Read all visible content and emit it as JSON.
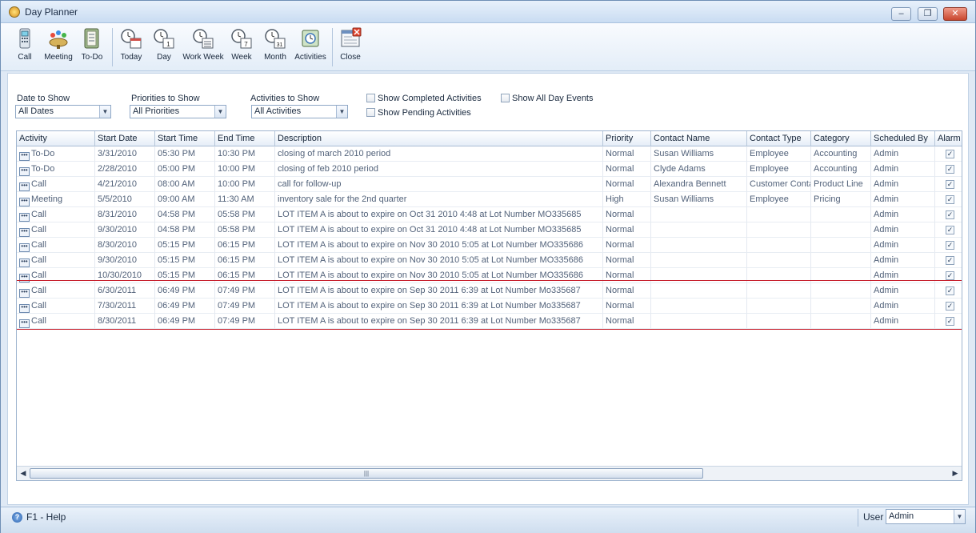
{
  "window": {
    "title": "Day Planner",
    "controls": {
      "minimize": "–",
      "restore": "❐",
      "close": "✕"
    }
  },
  "toolbar": {
    "buttons": [
      {
        "label": "Call",
        "icon": "phone-icon"
      },
      {
        "label": "Meeting",
        "icon": "meeting-icon"
      },
      {
        "label": "To-Do",
        "icon": "todo-icon"
      },
      {
        "label": "Today",
        "icon": "today-icon"
      },
      {
        "label": "Day",
        "icon": "day-icon"
      },
      {
        "label": "Work Week",
        "icon": "work-week-icon"
      },
      {
        "label": "Week",
        "icon": "week-icon"
      },
      {
        "label": "Month",
        "icon": "month-icon"
      },
      {
        "label": "Activities",
        "icon": "activities-icon"
      },
      {
        "label": "Close",
        "icon": "close-icon"
      }
    ],
    "icon_numbers": {
      "day": "1",
      "week": "7",
      "month": "31"
    }
  },
  "filters": {
    "date_label": "Date to Show",
    "date_value": "All Dates",
    "priorities_label": "Priorities to Show",
    "priorities_value": "All Priorities",
    "activities_label": "Activities to Show",
    "activities_value": "All Activities",
    "show_completed": "Show Completed Activities",
    "show_pending": "Show Pending Activities",
    "show_all_day": "Show All Day Events"
  },
  "grid": {
    "columns": [
      "Activity",
      "Start Date",
      "Start Time",
      "End Time",
      "Description",
      "Priority",
      "Contact Name",
      "Contact Type",
      "Category",
      "Scheduled By",
      "Alarm"
    ],
    "rows": [
      [
        "To-Do",
        "3/31/2010",
        "05:30 PM",
        "10:30 PM",
        "closing of march 2010 period",
        "Normal",
        "Susan Williams",
        "Employee",
        "Accounting",
        "Admin"
      ],
      [
        "To-Do",
        "2/28/2010",
        "05:00 PM",
        "10:00 PM",
        "closing of feb 2010 period",
        "Normal",
        "Clyde Adams",
        "Employee",
        "Accounting",
        "Admin"
      ],
      [
        "Call",
        "4/21/2010",
        "08:00 AM",
        "10:00 PM",
        "call for follow-up",
        "Normal",
        "Alexandra Bennett",
        "Customer Contact",
        "Product Line",
        "Admin"
      ],
      [
        "Meeting",
        "5/5/2010",
        "09:00 AM",
        "11:30 AM",
        "inventory sale for the 2nd quarter",
        "High",
        "Susan Williams",
        "Employee",
        "Pricing",
        "Admin"
      ],
      [
        "Call",
        "8/31/2010",
        "04:58 PM",
        "05:58 PM",
        "LOT ITEM A is about to expire on Oct 31 2010  4:48 at Lot Number MO335685",
        "Normal",
        "",
        "",
        "",
        "Admin"
      ],
      [
        "Call",
        "9/30/2010",
        "04:58 PM",
        "05:58 PM",
        "LOT ITEM A is about to expire on Oct 31 2010  4:48 at Lot Number MO335685",
        "Normal",
        "",
        "",
        "",
        "Admin"
      ],
      [
        "Call",
        "8/30/2010",
        "05:15 PM",
        "06:15 PM",
        "LOT ITEM A is about to expire on Nov 30 2010  5:05 at Lot Number MO335686",
        "Normal",
        "",
        "",
        "",
        "Admin"
      ],
      [
        "Call",
        "9/30/2010",
        "05:15 PM",
        "06:15 PM",
        "LOT ITEM A is about to expire on Nov 30 2010  5:05 at Lot Number MO335686",
        "Normal",
        "",
        "",
        "",
        "Admin"
      ],
      [
        "Call",
        "10/30/2010",
        "05:15 PM",
        "06:15 PM",
        "LOT ITEM A is about to expire on Nov 30 2010  5:05 at Lot Number MO335686",
        "Normal",
        "",
        "",
        "",
        "Admin"
      ],
      [
        "Call",
        "6/30/2011",
        "06:49 PM",
        "07:49 PM",
        "LOT ITEM A is about to expire on Sep 30 2011  6:39 at Lot Number Mo335687",
        "Normal",
        "",
        "",
        "",
        "Admin"
      ],
      [
        "Call",
        "7/30/2011",
        "06:49 PM",
        "07:49 PM",
        "LOT ITEM A is about to expire on Sep 30 2011  6:39 at Lot Number Mo335687",
        "Normal",
        "",
        "",
        "",
        "Admin"
      ],
      [
        "Call",
        "8/30/2011",
        "06:49 PM",
        "07:49 PM",
        "LOT ITEM A is about to expire on Sep 30 2011  6:39 at Lot Number Mo335687",
        "Normal",
        "",
        "",
        "",
        "Admin"
      ]
    ],
    "alarm_mark": "✓",
    "row_button_glyph": "•••",
    "highlighted_rows": [
      9,
      10,
      11
    ],
    "scroll_grip": "|||"
  },
  "statusbar": {
    "help": "F1 - Help",
    "help_glyph": "?",
    "user_label": "User",
    "user_value": "Admin"
  },
  "colors": {
    "highlight_frame": "#c7202d",
    "accent": "#2c62ad"
  }
}
